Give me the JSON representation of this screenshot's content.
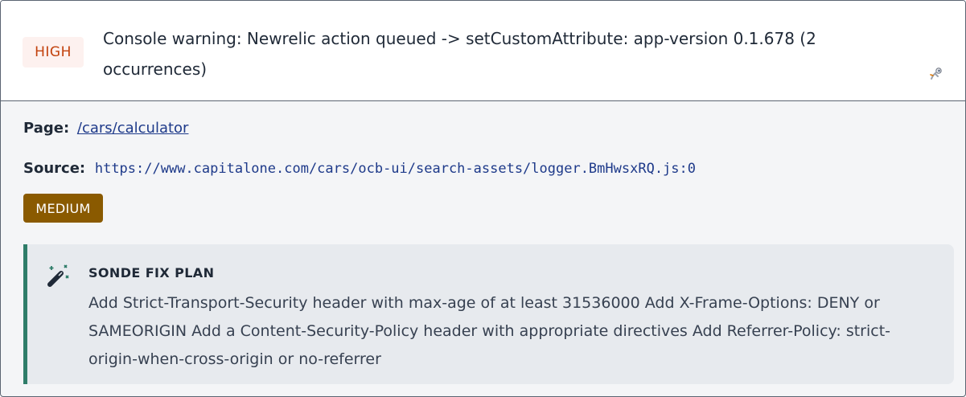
{
  "issue": {
    "severity": "HIGH",
    "title": "Console warning: Newrelic action queued -> setCustomAttribute: app-version 0.1.678 (2 occurrences)",
    "expand_icon": "astronaut-icon"
  },
  "details": {
    "page_label": "Page:",
    "page_value": "/cars/calculator",
    "source_label": "Source:",
    "source_value": "https://www.capitalone.com/cars/ocb-ui/search-assets/logger.BmHwsxRQ.js:0",
    "impact": "MEDIUM"
  },
  "fix_plan": {
    "icon": "magic-wand-icon",
    "heading": "SONDE FIX PLAN",
    "text": "Add Strict-Transport-Security header with max-age of at least 31536000 Add X-Frame-Options: DENY or SAMEORIGIN Add a Content-Security-Policy header with appropriate directives Add Referrer-Policy: strict-origin-when-cross-origin or no-referrer"
  },
  "colors": {
    "severity_high_text": "#c2410c",
    "severity_high_bg": "#fdf1ef",
    "impact_medium_bg": "#8a5a00",
    "fix_accent": "#2f7d69",
    "link": "#1e3a8a"
  }
}
